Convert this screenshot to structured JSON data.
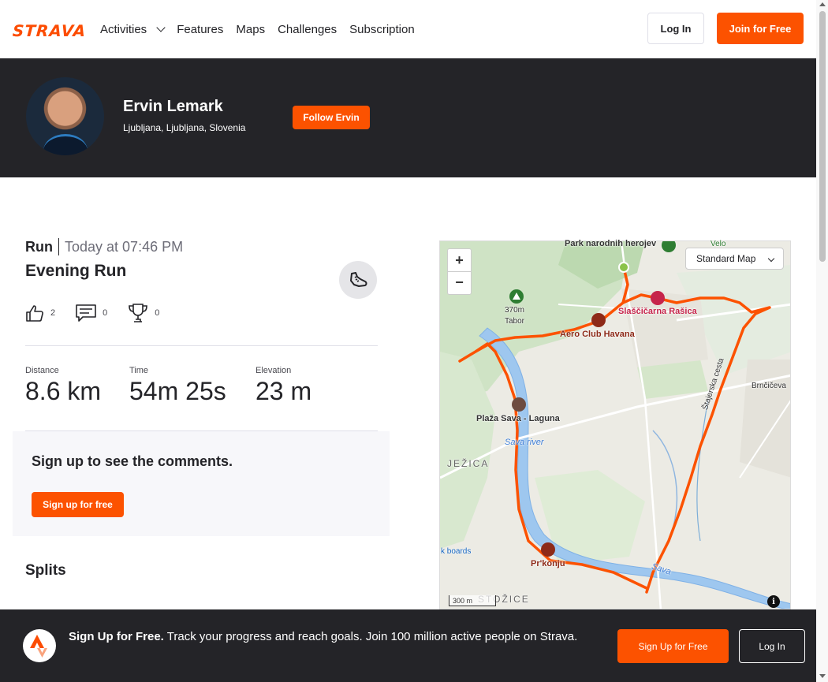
{
  "brand": {
    "logo_text": "STRAVA",
    "accent": "#fc5200",
    "dark": "#242428"
  },
  "nav": {
    "items": [
      {
        "label": "Activities",
        "has_dropdown": true
      },
      {
        "label": "Features"
      },
      {
        "label": "Maps"
      },
      {
        "label": "Challenges"
      },
      {
        "label": "Subscription"
      }
    ],
    "login_label": "Log In",
    "join_label": "Join for Free"
  },
  "athlete": {
    "name": "Ervin Lemark",
    "location": "Ljubljana, Ljubljana, Slovenia",
    "follow_label": "Follow Ervin"
  },
  "activity": {
    "type": "Run",
    "date": "Today at 07:46 PM",
    "title": "Evening Run",
    "kudos_count": "2",
    "comments_count": "0",
    "achievements_count": "0",
    "stats": [
      {
        "label": "Distance",
        "value": "8.6 km"
      },
      {
        "label": "Time",
        "value": "54m 25s"
      },
      {
        "label": "Elevation",
        "value": "23 m"
      }
    ]
  },
  "comments": {
    "title": "Sign up to see the comments.",
    "button_label": "Sign up for free"
  },
  "splits": {
    "title": "Splits"
  },
  "map": {
    "zoom_in": "+",
    "zoom_out": "−",
    "map_type": "Standard Map",
    "scale": "300 m",
    "info": "i",
    "labels": {
      "park": "Park narodnih herojev",
      "velo": "Velo",
      "peak": "370m Tabor",
      "peak_name": "370m",
      "peak_sub": "Tabor",
      "slascicarna": "Slaščičarna Rašica",
      "aeroclub": "Aero Club Havana",
      "plaza": "Plaža Sava - Laguna",
      "sava_river": "Sava river",
      "jezica": "JEŽICA",
      "brnciceva": "Brnčičeva",
      "stajerska": "Štajerska cesta",
      "boards": "k boards",
      "prkonju": "Pr'konju",
      "sava": "Sava",
      "stozice": "STOŽICE"
    }
  },
  "banner": {
    "bold_text": "Sign Up for Free.",
    "text": "Track your progress and reach goals. Join 100 million active people on Strava.",
    "signup_label": "Sign Up for Free",
    "login_label": "Log In"
  }
}
